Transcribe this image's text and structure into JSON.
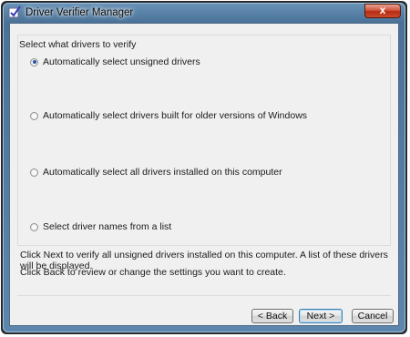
{
  "window": {
    "title": "Driver Verifier Manager",
    "close_label": "x"
  },
  "group": {
    "legend": "Select what drivers to verify",
    "options": [
      {
        "label": "Automatically select unsigned drivers",
        "checked": true
      },
      {
        "label": "Automatically select drivers built for older versions of Windows",
        "checked": false
      },
      {
        "label": "Automatically select all drivers installed on this computer",
        "checked": false
      },
      {
        "label": "Select driver names from a list",
        "checked": false
      }
    ]
  },
  "info": {
    "line1": "Click Next to verify all unsigned drivers installed on this computer. A list of these drivers will be displayed.",
    "line2": "Click Back to review or change the settings you want to create."
  },
  "buttons": {
    "back": "< Back",
    "next": "Next >",
    "cancel": "Cancel"
  },
  "colors": {
    "accent": "#2457a6",
    "titlebar": "#5c86ad",
    "close": "#c94a2c"
  }
}
